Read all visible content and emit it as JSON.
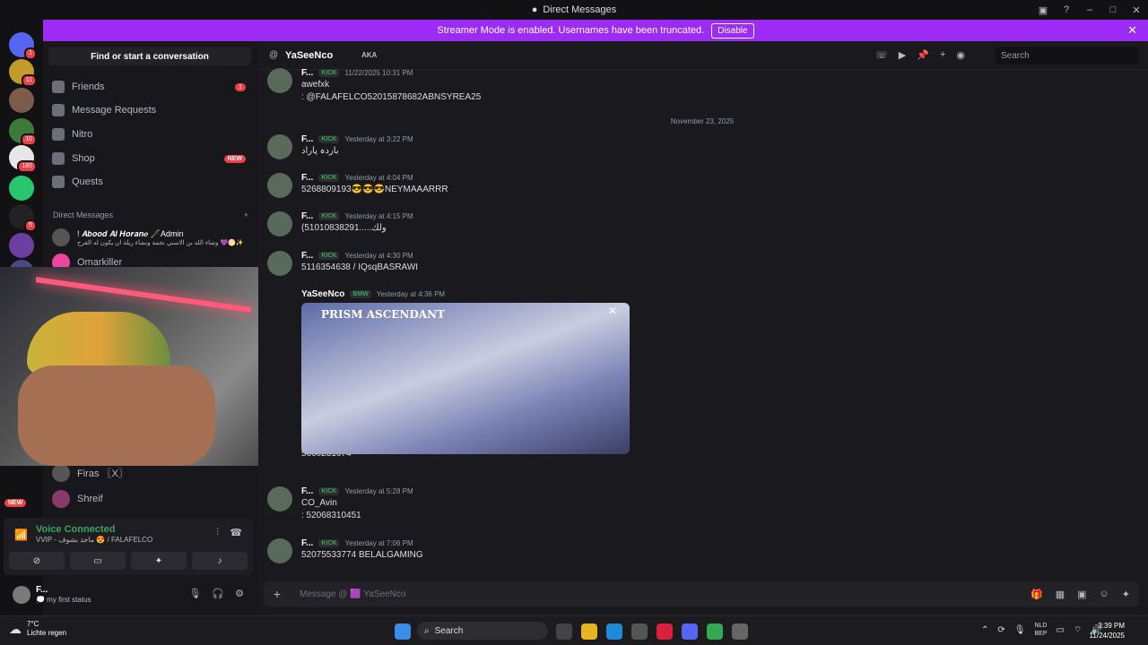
{
  "window": {
    "title": "Direct Messages"
  },
  "banner": {
    "text": "Streamer Mode is enabled. Usernames have been truncated.",
    "button": "Disable"
  },
  "servers": [
    {
      "badge": "1",
      "color": "#5865f2"
    },
    {
      "badge": "11",
      "color": "#c29b2a"
    },
    {
      "badge": "",
      "color": "#7b5c4a"
    },
    {
      "badge": "10",
      "color": "#3d7a3a"
    },
    {
      "badge": "180",
      "color": "#e6e6e6"
    },
    {
      "badge": "",
      "color": "#28c76f"
    },
    {
      "badge": "5",
      "color": "#222"
    },
    {
      "badge": "",
      "color": "#6b3fa0"
    },
    {
      "badge": "",
      "color": "#4a4a8a"
    }
  ],
  "sidebar": {
    "find": "Find or start a conversation",
    "nav": [
      {
        "label": "Friends",
        "count": "1",
        "icon": "friends-icon"
      },
      {
        "label": "Message Requests",
        "count": "",
        "icon": "mail-icon"
      },
      {
        "label": "Nitro",
        "count": "",
        "icon": "nitro-icon"
      },
      {
        "label": "Shop",
        "count": "NEW",
        "icon": "shop-icon"
      },
      {
        "label": "Quests",
        "count": "",
        "icon": "quests-icon"
      }
    ],
    "dm_header": "Direct Messages",
    "dm_add": "+",
    "dms": [
      {
        "name": "! 𝑨𝒃𝒐𝒐𝒅 𝑨𝒍 𝑯𝒐𝒓𝒂𝒏𝒆 🖋️Admin",
        "sub": "وشاء الله بن الاسني نجمة ونشاء ريلة ان يكون له الفرح 💜🌕✨"
      },
      {
        "name": "Omarkiller",
        "sub": ""
      },
      {
        "name": "Firas 〖X〗",
        "sub": ""
      },
      {
        "name": "Shreif",
        "sub": ""
      }
    ],
    "new_badge": "NEW"
  },
  "voice": {
    "status": "Voice Connected",
    "channel": "VVIP - ماجد بشوف 😍 / FALAFELCO"
  },
  "user": {
    "name": "F...",
    "status": "💭 my first status"
  },
  "chat": {
    "header_name": "YaSeeNco",
    "aka": "AKA",
    "search_placeholder": "Search",
    "date_divider": "November 23, 2025",
    "messages": [
      {
        "author": "F...",
        "tag": "KICK",
        "time": "11/22/2025 10:31 PM",
        "lines": [
          "awefxk",
          ": @FALAFELCO52015878682ABNSYREA25"
        ]
      },
      {
        "author": "F...",
        "tag": "KICK",
        "time": "Yesterday at 3:22 PM",
        "lines": [
          "باردہ پاراد"
        ]
      },
      {
        "author": "F...",
        "tag": "KICK",
        "time": "Yesterday at 4:04 PM",
        "lines": [
          "5268809193😎😎😎NEYMAAARRR"
        ]
      },
      {
        "author": "F...",
        "tag": "KICK",
        "time": "Yesterday at 4:15 PM",
        "lines": [
          "(ولك.....51010838291"
        ]
      },
      {
        "author": "F...",
        "tag": "KICK",
        "time": "Yesterday at 4:30 PM",
        "lines": [
          "5116354638 / IQsqBASRAWI"
        ]
      },
      {
        "author": "YaSeeNco",
        "tag": "BMW",
        "time": "Yesterday at 4:36 PM",
        "lines": [
          "5660231674"
        ]
      },
      {
        "author": "F...",
        "tag": "KICK",
        "time": "Yesterday at 5:28 PM",
        "lines": [
          "CO_Avin",
          ": 52068310451"
        ]
      },
      {
        "author": "F...",
        "tag": "KICK",
        "time": "Yesterday at 7:06 PM",
        "lines": [
          "52075533774 BELALGAMING"
        ]
      }
    ],
    "image_title": "PRISM ASCENDANT",
    "composer_placeholder": "Message @ 🟪 YaSeeNco"
  },
  "taskbar": {
    "temp": "7°C",
    "weather": "Lichte regen",
    "search": "Search",
    "lang1": "NLD",
    "lang2": "BEP",
    "time": "3:39 PM",
    "date": "11/24/2025"
  }
}
